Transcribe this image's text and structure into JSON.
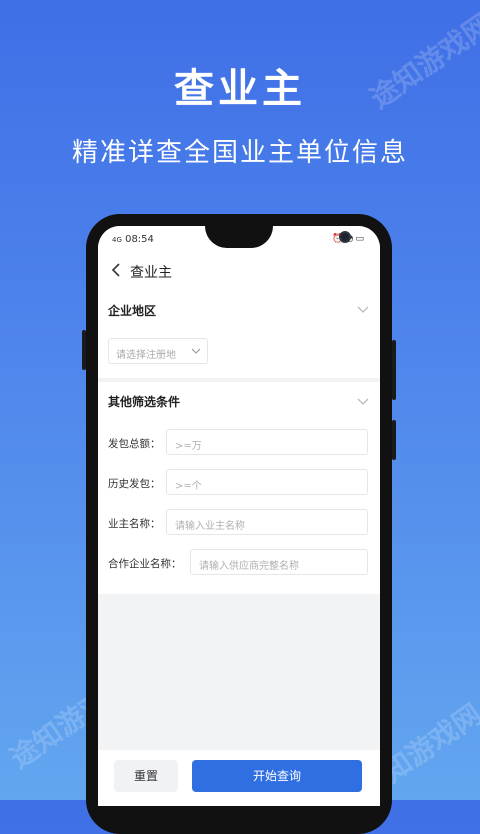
{
  "hero": {
    "title": "查业主",
    "subtitle": "精准详查全国业主单位信息"
  },
  "watermark": "途知游戏网",
  "status_bar": {
    "time": "08:54",
    "signal": "4G"
  },
  "nav": {
    "title": "查业主"
  },
  "region_section": {
    "title": "企业地区",
    "select_placeholder": "请选择注册地"
  },
  "filter_section": {
    "title": "其他筛选条件",
    "fields": [
      {
        "label": "发包总额：",
        "placeholder": ">=万"
      },
      {
        "label": "历史发包：",
        "placeholder": ">=个"
      },
      {
        "label": "业主名称：",
        "placeholder": "请输入业主名称"
      },
      {
        "label": "合作企业名称：",
        "placeholder": "请输入供应商完整名称"
      }
    ]
  },
  "actions": {
    "reset_label": "重置",
    "query_label": "开始查询"
  },
  "colors": {
    "primary": "#2f6fe2",
    "bg_top": "#3f6fe6",
    "bg_bottom": "#62a6ef"
  }
}
